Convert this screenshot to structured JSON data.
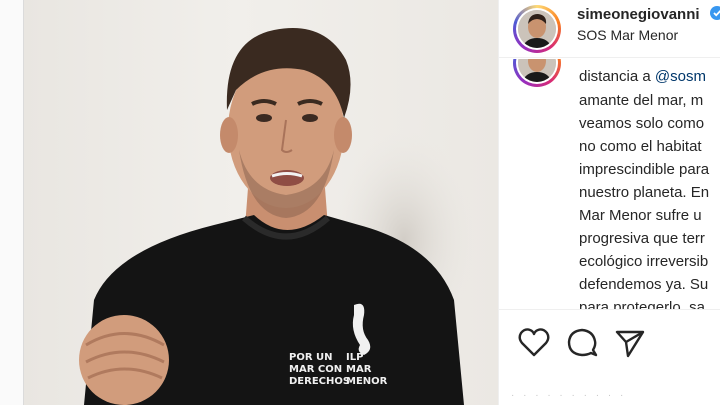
{
  "post": {
    "username": "simeonegiovanni",
    "location": "SOS Mar Menor",
    "shirt_text": {
      "left": [
        "POR UN",
        "MAR CON",
        "DERECHOS"
      ],
      "right": [
        "ILP",
        "MAR",
        "MENOR"
      ]
    },
    "caption": {
      "line1_prefix": "distancia a ",
      "line1_mention": "@sosm",
      "lines": [
        "amante del mar, m",
        "veamos solo como",
        "no como el habitat",
        "imprescindible para",
        "nuestro planeta. En",
        "Mar Menor sufre u",
        "progresiva que terr",
        "ecológico irreversib",
        "defendemos ya. Su",
        "para protegerlo, sa"
      ]
    }
  },
  "icons": {
    "like": "heart-icon",
    "comment": "comment-icon",
    "share": "share-icon",
    "verified": "verified-badge-icon"
  },
  "colors": {
    "text": "#262626",
    "mention": "#00376b",
    "verified": "#3897f0",
    "shirt": "#111111"
  }
}
